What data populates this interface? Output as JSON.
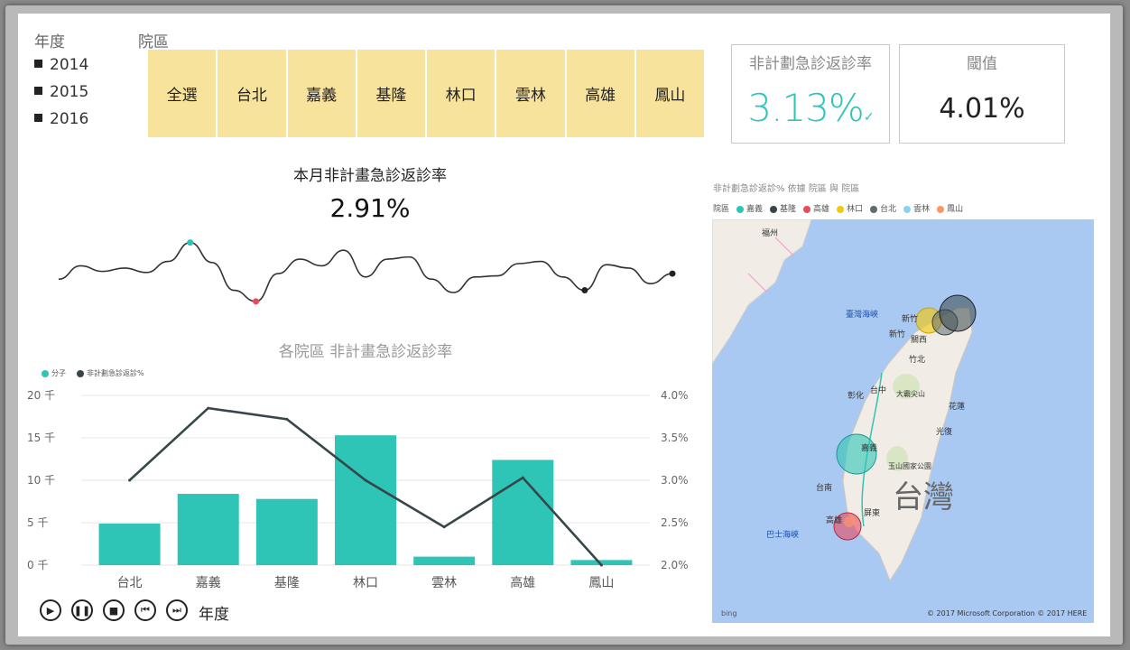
{
  "year_slicer": {
    "title": "年度",
    "years": [
      "2014",
      "2015",
      "2016"
    ]
  },
  "district_slicer": {
    "title": "院區",
    "options": [
      "全選",
      "台北",
      "嘉義",
      "基隆",
      "林口",
      "雲林",
      "高雄",
      "鳳山"
    ]
  },
  "kpi_card": {
    "title": "非計劃急診返診率",
    "value": "3.13%",
    "status_icon": "check-mark-icon",
    "check": "✓"
  },
  "threshold_card": {
    "title": "閾值",
    "value": "4.01%"
  },
  "monthly": {
    "title": "本月非計畫急診返診率",
    "value": "2.91%"
  },
  "district_chart": {
    "title": "各院區 非計畫急診返診率",
    "legend": [
      "分子",
      "非計劃急診返診%"
    ]
  },
  "chart_data": {
    "type": "bar",
    "title": "各院區 非計畫急診返診率",
    "categories": [
      "台北",
      "嘉義",
      "基隆",
      "林口",
      "雲林",
      "高雄",
      "鳳山"
    ],
    "series": [
      {
        "name": "分子",
        "kind": "bar",
        "axis": "left",
        "color": "#2ec4b6",
        "values": [
          4.9,
          8.4,
          7.8,
          15.3,
          1.0,
          12.4,
          0.6
        ]
      },
      {
        "name": "非計劃急診返診%",
        "kind": "line",
        "axis": "right",
        "color": "#374649",
        "values": [
          3.0,
          3.85,
          3.72,
          3.0,
          2.45,
          3.03,
          2.0
        ]
      }
    ],
    "y_left": {
      "ticks": [
        "0 千",
        "5 千",
        "10 千",
        "15 千",
        "20 千"
      ],
      "ylim": [
        0,
        20
      ]
    },
    "y_right": {
      "ticks": [
        "2.0%",
        "2.5%",
        "3.0%",
        "3.5%",
        "4.0%"
      ],
      "ylim": [
        2.0,
        4.0
      ]
    },
    "grid": true,
    "legend_position": "top-left"
  },
  "sparkline": {
    "values": [
      2.7,
      2.82,
      2.77,
      2.8,
      2.76,
      2.86,
      3.03,
      2.85,
      2.6,
      2.5,
      2.75,
      2.88,
      2.82,
      2.96,
      2.72,
      2.88,
      2.9,
      2.7,
      2.58,
      2.72,
      2.73,
      2.84,
      2.86,
      2.72,
      2.6,
      2.83,
      2.8,
      2.66,
      2.75
    ],
    "marks": [
      {
        "index": 6,
        "color": "#2ec4b6"
      },
      {
        "index": 9,
        "color": "#e84a5f"
      },
      {
        "index": 24,
        "color": "#222"
      },
      {
        "index": 28,
        "color": "#222"
      }
    ]
  },
  "play_axis": {
    "label": "年度",
    "controls": [
      "play",
      "pause",
      "stop",
      "previous",
      "next"
    ]
  },
  "map": {
    "title": "非計劃急診返診% 依據 院區 與 院區",
    "legend_title": "院區",
    "legend": [
      {
        "name": "嘉義",
        "color": "#2ec4b6"
      },
      {
        "name": "基隆",
        "color": "#374649"
      },
      {
        "name": "高雄",
        "color": "#e84a5f"
      },
      {
        "name": "林口",
        "color": "#f2c811"
      },
      {
        "name": "台北",
        "color": "#5f6b6d"
      },
      {
        "name": "雲林",
        "color": "#8ad4eb"
      },
      {
        "name": "鳳山",
        "color": "#fe9666"
      }
    ],
    "labels": [
      "福州",
      "臺灣海峽",
      "新竹",
      "竹北",
      "台中",
      "彰化",
      "花蓮",
      "光復",
      "嘉義",
      "玉山國家公園",
      "台南",
      "高雄",
      "屏東",
      "巴士海峽",
      "台灣",
      "大霸尖山",
      "新竹",
      "關西"
    ],
    "copyright": "© 2017 Microsoft Corporation   © 2017 HERE",
    "provider": "bing"
  }
}
